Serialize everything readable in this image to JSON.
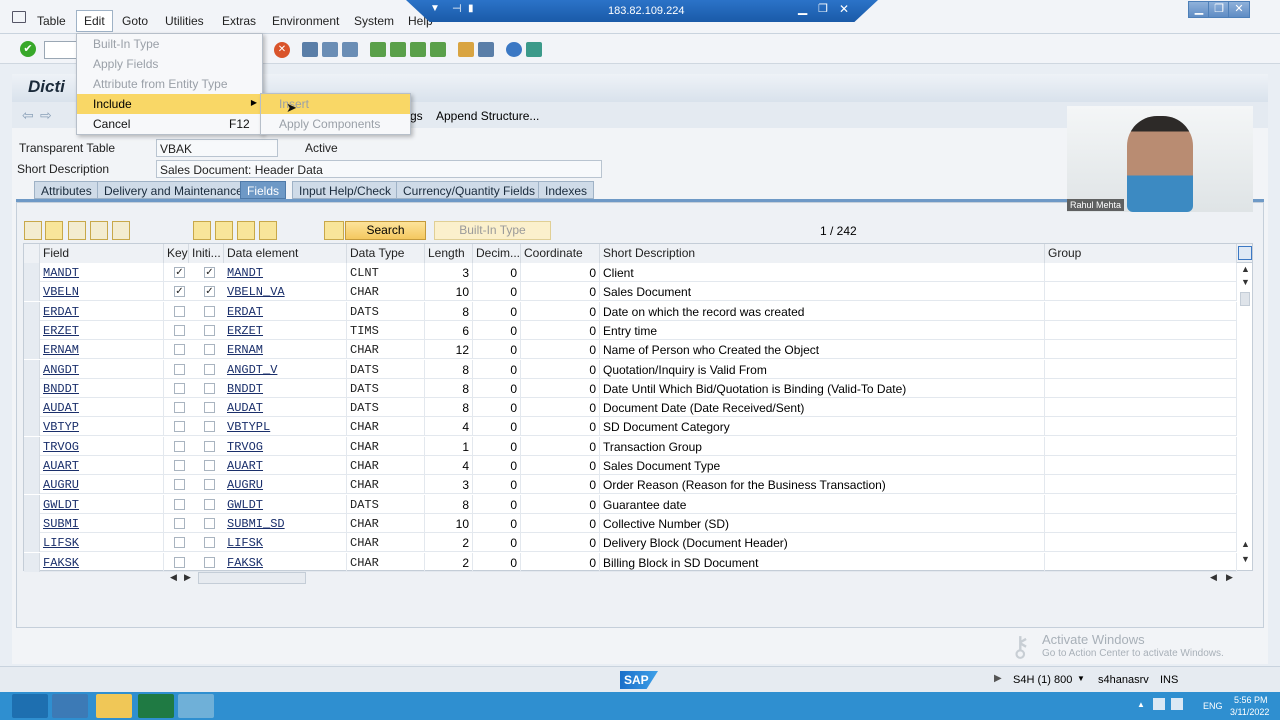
{
  "menu": {
    "items": [
      "Table",
      "Edit",
      "Goto",
      "Utilities",
      "Extras",
      "Environment",
      "System",
      "Help"
    ]
  },
  "remote": {
    "host": "183.82.109.224"
  },
  "title": "Dicti",
  "app_toolbar": {
    "tail": "gs",
    "append_structure": "Append Structure..."
  },
  "header": {
    "table_label": "Transparent Table",
    "table_value": "VBAK",
    "status": "Active",
    "desc_label": "Short Description",
    "desc_value": "Sales Document: Header Data"
  },
  "tabs": [
    "Attributes",
    "Delivery and Maintenance",
    "Fields",
    "Input Help/Check",
    "Currency/Quantity Fields",
    "Indexes"
  ],
  "active_tab": "Fields",
  "grid_toolbar": {
    "search": "Search",
    "builtin": "Built-In Type",
    "pager": "1  /  242"
  },
  "columns": [
    "Field",
    "Key",
    "Initi...",
    "Data element",
    "Data Type",
    "Length",
    "Decim...",
    "Coordinate",
    "Short Description",
    "Group"
  ],
  "rows": [
    {
      "field": "MANDT",
      "key": true,
      "init": true,
      "de": "MANDT",
      "type": "CLNT",
      "len": "3",
      "dec": "0",
      "coord": "0",
      "desc": "Client"
    },
    {
      "field": "VBELN",
      "key": true,
      "init": true,
      "de": "VBELN_VA",
      "type": "CHAR",
      "len": "10",
      "dec": "0",
      "coord": "0",
      "desc": "Sales Document"
    },
    {
      "field": "ERDAT",
      "key": false,
      "init": false,
      "de": "ERDAT",
      "type": "DATS",
      "len": "8",
      "dec": "0",
      "coord": "0",
      "desc": "Date on which the record was created"
    },
    {
      "field": "ERZET",
      "key": false,
      "init": false,
      "de": "ERZET",
      "type": "TIMS",
      "len": "6",
      "dec": "0",
      "coord": "0",
      "desc": "Entry time"
    },
    {
      "field": "ERNAM",
      "key": false,
      "init": false,
      "de": "ERNAM",
      "type": "CHAR",
      "len": "12",
      "dec": "0",
      "coord": "0",
      "desc": "Name of Person who Created the Object"
    },
    {
      "field": "ANGDT",
      "key": false,
      "init": false,
      "de": "ANGDT_V",
      "type": "DATS",
      "len": "8",
      "dec": "0",
      "coord": "0",
      "desc": "Quotation/Inquiry is Valid From"
    },
    {
      "field": "BNDDT",
      "key": false,
      "init": false,
      "de": "BNDDT",
      "type": "DATS",
      "len": "8",
      "dec": "0",
      "coord": "0",
      "desc": "Date Until Which Bid/Quotation is Binding (Valid-To Date)"
    },
    {
      "field": "AUDAT",
      "key": false,
      "init": false,
      "de": "AUDAT",
      "type": "DATS",
      "len": "8",
      "dec": "0",
      "coord": "0",
      "desc": "Document Date (Date Received/Sent)"
    },
    {
      "field": "VBTYP",
      "key": false,
      "init": false,
      "de": "VBTYPL",
      "type": "CHAR",
      "len": "4",
      "dec": "0",
      "coord": "0",
      "desc": "SD Document Category"
    },
    {
      "field": "TRVOG",
      "key": false,
      "init": false,
      "de": "TRVOG",
      "type": "CHAR",
      "len": "1",
      "dec": "0",
      "coord": "0",
      "desc": "Transaction Group"
    },
    {
      "field": "AUART",
      "key": false,
      "init": false,
      "de": "AUART",
      "type": "CHAR",
      "len": "4",
      "dec": "0",
      "coord": "0",
      "desc": "Sales Document Type"
    },
    {
      "field": "AUGRU",
      "key": false,
      "init": false,
      "de": "AUGRU",
      "type": "CHAR",
      "len": "3",
      "dec": "0",
      "coord": "0",
      "desc": "Order Reason (Reason for the Business Transaction)"
    },
    {
      "field": "GWLDT",
      "key": false,
      "init": false,
      "de": "GWLDT",
      "type": "DATS",
      "len": "8",
      "dec": "0",
      "coord": "0",
      "desc": "Guarantee date"
    },
    {
      "field": "SUBMI",
      "key": false,
      "init": false,
      "de": "SUBMI_SD",
      "type": "CHAR",
      "len": "10",
      "dec": "0",
      "coord": "0",
      "desc": "Collective Number (SD)"
    },
    {
      "field": "LIFSK",
      "key": false,
      "init": false,
      "de": "LIFSK",
      "type": "CHAR",
      "len": "2",
      "dec": "0",
      "coord": "0",
      "desc": "Delivery Block (Document Header)"
    },
    {
      "field": "FAKSK",
      "key": false,
      "init": false,
      "de": "FAKSK",
      "type": "CHAR",
      "len": "2",
      "dec": "0",
      "coord": "0",
      "desc": "Billing Block in SD Document"
    }
  ],
  "edit_menu": {
    "items": [
      {
        "label": "Built-In Type",
        "enabled": false,
        "shortcut": ""
      },
      {
        "label": "Apply Fields",
        "enabled": false,
        "shortcut": ""
      },
      {
        "label": "Attribute from Entity Type",
        "enabled": false,
        "shortcut": ""
      },
      {
        "label": "Include",
        "enabled": true,
        "shortcut": ""
      },
      {
        "label": "Cancel",
        "enabled": true,
        "shortcut": "F12"
      }
    ]
  },
  "include_submenu": {
    "items": [
      "Insert",
      "Apply Components"
    ]
  },
  "webcam": {
    "name": "Rahul Mehta"
  },
  "watermark": {
    "title": "Activate Windows",
    "subtitle": "Go to Action Center to activate Windows."
  },
  "status": {
    "logo": "SAP",
    "system": "S4H (1) 800",
    "server": "s4hanasrv",
    "mode": "INS"
  },
  "taskbar": {
    "lang": "ENG",
    "time": "5:56 PM",
    "date": "3/11/2022"
  },
  "colors": {
    "accent": "#6e99c6",
    "highlight": "#f9d766",
    "taskbar": "#2f8fd0"
  }
}
